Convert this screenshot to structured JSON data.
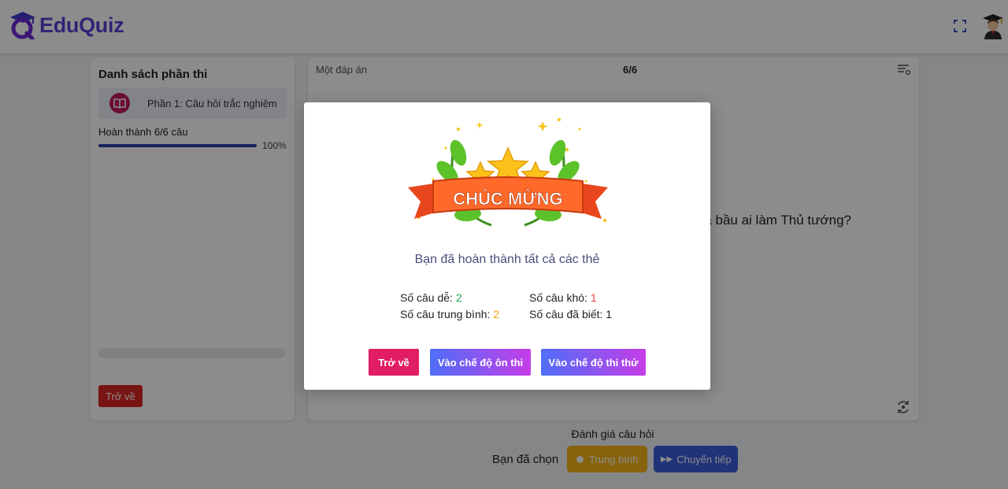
{
  "header": {
    "logo_text": "EduQuiz",
    "brand_color": "#5b3fd6",
    "fullscreen_icon": "fullscreen-icon",
    "avatar_icon": "graduate-avatar"
  },
  "sidebar": {
    "title": "Danh sách phần thi",
    "sections": [
      {
        "label": "Phần 1: Câu hỏi trắc nghiệm",
        "icon": "book-icon"
      }
    ],
    "progress_text": "Hoàn thành 6/6 câu",
    "progress_value": 1.0,
    "progress_percent": "100%",
    "back_label": "Trở về"
  },
  "question": {
    "type_label": "Một đáp án",
    "counter": "6/6",
    "text": "đã bầu ai làm Thủ tướng?"
  },
  "evaluation": {
    "title": "Đánh giá câu hỏi",
    "chosen_label": "Bạn đã chọn",
    "selected_level": "Trung bình",
    "next_label": "Chuyển tiếp"
  },
  "modal": {
    "banner_text": "CHÚC MỪNG",
    "message": "Bạn đã hoàn thành tất cả các thẻ",
    "stats": {
      "easy_label": "Số câu dễ:",
      "easy_value": "2",
      "hard_label": "Số câu khó:",
      "hard_value": "1",
      "medium_label": "Số câu trung bình:",
      "medium_value": "2",
      "known_label": "Số câu đã biết:",
      "known_value": "1"
    },
    "buttons": {
      "back": "Trở về",
      "review_mode": "Vào chế độ ôn thi",
      "exam_mode": "Vào chế độ thi thử"
    }
  },
  "colors": {
    "accent_blue": "#3b5bdb",
    "danger": "#dc2626",
    "medium_yellow": "#f4b516",
    "easy_green": "#16a34a",
    "hard_red": "#ef4444"
  }
}
